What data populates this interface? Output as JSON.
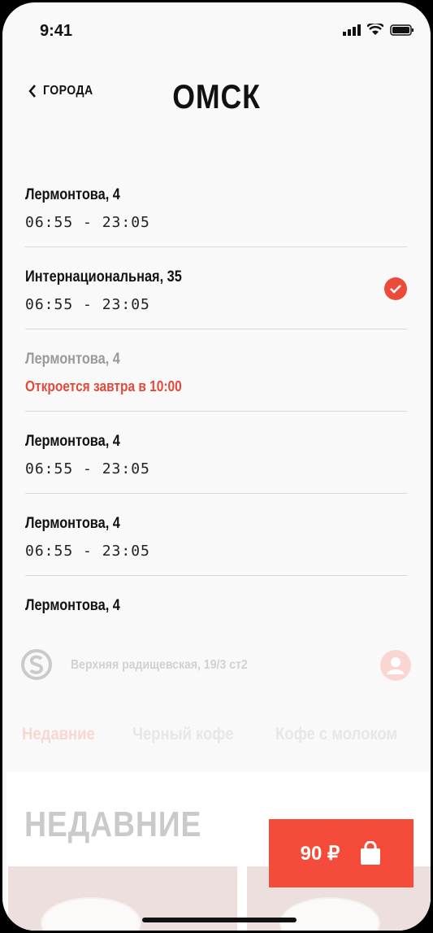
{
  "status": {
    "time": "9:41"
  },
  "header": {
    "back_label": "ГОРОДА",
    "city": "ОМСК"
  },
  "stores": [
    {
      "name": "Лермонтова, 4",
      "hours": "06:55 - 23:05",
      "state": "open"
    },
    {
      "name": "Интернациональная, 35",
      "hours": "06:55 - 23:05",
      "state": "selected"
    },
    {
      "name": "Лермонтова, 4",
      "notice": "Откроется завтра в 10:00",
      "state": "closed"
    },
    {
      "name": "Лермонтова, 4",
      "hours": "06:55 - 23:05",
      "state": "open"
    },
    {
      "name": "Лермонтова, 4",
      "hours": "06:55 - 23:05",
      "state": "open"
    },
    {
      "name": "Лермонтова, 4",
      "state": "open"
    }
  ],
  "background": {
    "address": "Верхняя радищевская, 19/3 ст2",
    "tabs": [
      "Недавние",
      "Черный кофе",
      "Кофе с молоком"
    ],
    "active_tab": 0,
    "section_title": "НЕДАВНИЕ",
    "cart": {
      "price": "90 ₽"
    }
  },
  "colors": {
    "accent": "#f44b3a",
    "check": "#ec4a3a",
    "notice": "#e34a3b",
    "tab_active": "#f3a59b"
  }
}
